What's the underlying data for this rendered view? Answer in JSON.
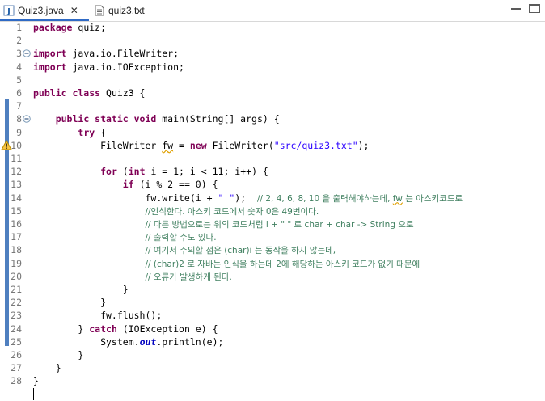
{
  "tabs": [
    {
      "label": "Quiz3.java",
      "active": true,
      "close": "✕"
    },
    {
      "label": "quiz3.txt",
      "active": false
    }
  ],
  "editor": {
    "lines": [
      {
        "n": "1",
        "html": "<span class=\"kw\">package</span> quiz;"
      },
      {
        "n": "2",
        "html": ""
      },
      {
        "n": "3",
        "html": "<span class=\"kw\">import</span> java.io.FileWriter;",
        "fold": true
      },
      {
        "n": "4",
        "html": "<span class=\"kw\">import</span> java.io.IOException;"
      },
      {
        "n": "5",
        "html": ""
      },
      {
        "n": "6",
        "html": "<span class=\"kw\">public class</span> Quiz3 {"
      },
      {
        "n": "7",
        "html": ""
      },
      {
        "n": "8",
        "html": "    <span class=\"kw\">public static void</span> main(String[] args) {",
        "fold": true
      },
      {
        "n": "9",
        "html": "        <span class=\"kw\">try</span> {"
      },
      {
        "n": "10",
        "html": "            FileWriter <span class=\"squig\">fw</span> = <span class=\"kw\">new</span> FileWriter(<span class=\"str\">\"src/quiz3.txt\"</span>);",
        "warn": true
      },
      {
        "n": "11",
        "html": ""
      },
      {
        "n": "12",
        "html": "            <span class=\"kw\">for</span> (<span class=\"kw\">int</span> i = 1; i &lt; 11; i++) {"
      },
      {
        "n": "13",
        "html": "                <span class=\"kw\">if</span> (i % 2 == 0) {"
      },
      {
        "n": "14",
        "html": "                    fw.write(i + <span class=\"str\">\" \"</span>);  <span class=\"cm\">// 2, 4, 6, 8, 10 을 출력해야하는데, <span class=\"squig\">fw</span> 는 아스키코드로</span>"
      },
      {
        "n": "15",
        "html": "                    <span class=\"cm\">//인식한다. 아스키 코드에서 숫자 0은 49번이다.</span>"
      },
      {
        "n": "16",
        "html": "                    <span class=\"cm\">// 다른 방법으로는 위의 코드처럼 i + \" \" 로 char + char -&gt; String 으로</span>"
      },
      {
        "n": "17",
        "html": "                    <span class=\"cm\">// 출력할 수도 있다.</span>"
      },
      {
        "n": "18",
        "html": "                    <span class=\"cm\">// 여기서 주의할 점은 (char)i 는 동작을 하지 않는데,</span>"
      },
      {
        "n": "19",
        "html": "                    <span class=\"cm\">// (char)2 로 자바는 인식을 하는데 2에 해당하는 아스키 코드가 없기 때문에</span>"
      },
      {
        "n": "20",
        "html": "                    <span class=\"cm\">// 오류가 발생하게 된다.</span>"
      },
      {
        "n": "21",
        "html": "                }"
      },
      {
        "n": "22",
        "html": "            }"
      },
      {
        "n": "23",
        "html": "            fw.flush();"
      },
      {
        "n": "24",
        "html": "        } <span class=\"kw\">catch</span> (IOException e) {"
      },
      {
        "n": "25",
        "html": "            System.<span class=\"ital\">out</span>.println(e);"
      },
      {
        "n": "26",
        "html": "        }"
      },
      {
        "n": "27",
        "html": "    }"
      },
      {
        "n": "28",
        "html": "}"
      },
      {
        "n": "",
        "html": ""
      }
    ]
  }
}
